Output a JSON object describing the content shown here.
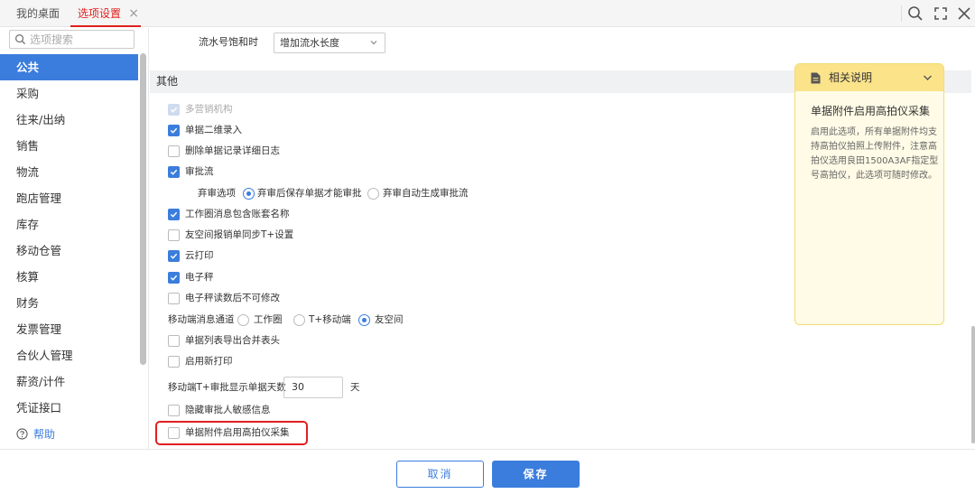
{
  "tabs": [
    {
      "label": "我的桌面"
    },
    {
      "label": "选项设置",
      "close": "×"
    }
  ],
  "sidebar": {
    "search_placeholder": "选项搜索",
    "items": [
      "公共",
      "采购",
      "往来/出纳",
      "销售",
      "物流",
      "跑店管理",
      "库存",
      "移动仓管",
      "核算",
      "财务",
      "发票管理",
      "合伙人管理",
      "薪资/计件",
      "凭证接口"
    ],
    "active_index": 0,
    "help": "帮助"
  },
  "main": {
    "top_row": {
      "label": "流水号饱和时",
      "select_value": "增加流水长度"
    },
    "section_title": "其他",
    "options": [
      {
        "label": "多营销机构",
        "checked": true,
        "disabled": true
      },
      {
        "label": "单据二维录入",
        "checked": true
      },
      {
        "label": "删除单据记录详细日志",
        "checked": false
      },
      {
        "label": "审批流",
        "checked": true
      },
      {
        "label": "工作圈消息包含账套名称",
        "checked": true
      },
      {
        "label": "友空间报销单同步T+设置",
        "checked": false
      },
      {
        "label": "云打印",
        "checked": true
      },
      {
        "label": "电子秤",
        "checked": true
      },
      {
        "label": "电子秤读数后不可修改",
        "checked": false
      },
      {
        "label": "单据列表导出合并表头",
        "checked": false
      },
      {
        "label": "启用新打印",
        "checked": false
      },
      {
        "label": "隐藏审批人敏感信息",
        "checked": false
      },
      {
        "label": "单据附件启用高拍仪采集",
        "checked": false
      }
    ],
    "reject_option": {
      "label": "弃审选项",
      "choices": [
        "弃审后保存单据才能审批",
        "弃审自动生成审批流"
      ],
      "selected": 0
    },
    "mobile_channel": {
      "label": "移动端消息通道",
      "choices": [
        "工作圈",
        "T+移动端",
        "友空间"
      ],
      "selected": 2
    },
    "days_row": {
      "label": "移动端T+审批显示单据天数",
      "value": "30",
      "unit": "天"
    }
  },
  "help_panel": {
    "title": "相关说明",
    "subtitle": "单据附件启用高拍仪采集",
    "description": "启用此选项，所有单据附件均支持高拍仪拍照上传附件，注意高拍仪选用良田1500A3AF指定型号高拍仪，此选项可随时修改。"
  },
  "footer": {
    "cancel": "取消",
    "save": "保存"
  },
  "colors": {
    "accent": "#3b7ddd",
    "highlight": "#e02020",
    "panel_bg": "#fffbe6",
    "panel_head": "#fbe38a"
  }
}
